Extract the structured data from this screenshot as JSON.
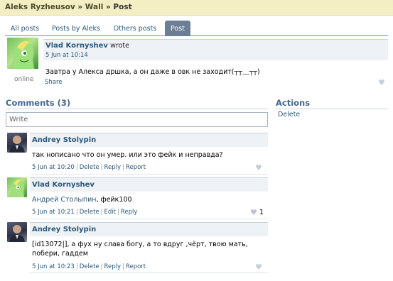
{
  "breadcrumb": {
    "user": "Aleks Ryzheusov",
    "sep1": "»",
    "section": "Wall",
    "sep2": "»",
    "page": "Post"
  },
  "tabs": [
    {
      "label": "All posts",
      "active": false
    },
    {
      "label": "Posts by Aleks",
      "active": false
    },
    {
      "label": "Others posts",
      "active": false
    },
    {
      "label": "Post",
      "active": true
    }
  ],
  "post": {
    "author": "Vlad Kornyshev",
    "wrote": "wrote",
    "date": "5 Jun at 10:14",
    "text": "Завтра у Алекса дршка, а он даже в овк не заходит(┬┬﹏┬┬)",
    "status": "online",
    "share_label": "Share",
    "like_icon": "heart-icon"
  },
  "comments_section": {
    "title": "Comments (3)",
    "write_placeholder": "Write"
  },
  "actions_section": {
    "title": "Actions",
    "delete_label": "Delete"
  },
  "comments": [
    {
      "author": "Andrey Stolypin",
      "avatar": "man-avatar",
      "text": "так нописано что он умер. или это фейк и неправда?",
      "date": "5 Jun at 10:20",
      "actions": [
        "Delete",
        "Reply",
        "Report"
      ],
      "likes": ""
    },
    {
      "author": "Vlad Kornyshev",
      "avatar": "pony-avatar",
      "mention": "Андрей Столыпин",
      "text": ", фейк100",
      "date": "5 Jun at 10:21",
      "actions": [
        "Delete",
        "Edit",
        "Reply"
      ],
      "likes": "1"
    },
    {
      "author": "Andrey Stolypin",
      "avatar": "man-avatar",
      "text": "[id13072|], а фух ну слава богу, а то вдруг ,чёрт, твою мать, побери, гаддем",
      "date": "5 Jun at 10:23",
      "actions": [
        "Delete",
        "Reply",
        "Report"
      ],
      "likes": ""
    }
  ],
  "colors": {
    "link": "#2B587A",
    "title": "#45688E",
    "topbar": "#F4EEC4",
    "active_tab": "#6A7F95",
    "header_bg": "#EEF1F5"
  }
}
